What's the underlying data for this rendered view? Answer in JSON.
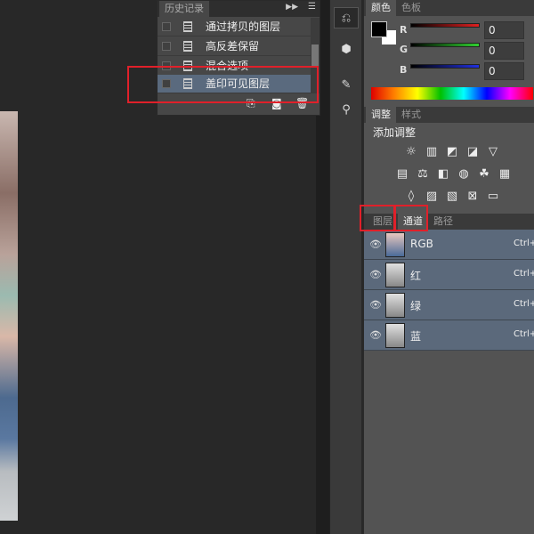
{
  "history": {
    "tab": "历史记录",
    "items": [
      {
        "label": "通过拷贝的图层"
      },
      {
        "label": "高反差保留"
      },
      {
        "label": "混合选项"
      },
      {
        "label": "盖印可见图层"
      }
    ]
  },
  "color": {
    "tabs": [
      "颜色",
      "色板"
    ],
    "channels": [
      {
        "label": "R",
        "value": "0",
        "color": "#d02020"
      },
      {
        "label": "G",
        "value": "0",
        "color": "#20c020"
      },
      {
        "label": "B",
        "value": "0",
        "color": "#2020d0"
      }
    ]
  },
  "adjustments": {
    "tabs": [
      "调整",
      "样式"
    ],
    "title": "添加调整",
    "icons": [
      [
        "☼",
        "▥",
        "◩",
        "◪",
        "▽"
      ],
      [
        "▤",
        "⚖",
        "◧",
        "◍",
        "☘",
        "▦"
      ],
      [
        "◊",
        "▨",
        "▧",
        "⊠",
        "▭"
      ]
    ]
  },
  "channels_panel": {
    "tabs": [
      "图层",
      "通道",
      "路径"
    ],
    "rows": [
      {
        "name": "RGB",
        "shortcut": "Ctrl+"
      },
      {
        "name": "红",
        "shortcut": "Ctrl+"
      },
      {
        "name": "绿",
        "shortcut": "Ctrl+"
      },
      {
        "name": "蓝",
        "shortcut": "Ctrl+"
      }
    ]
  },
  "icons": {
    "eye": "👁"
  }
}
